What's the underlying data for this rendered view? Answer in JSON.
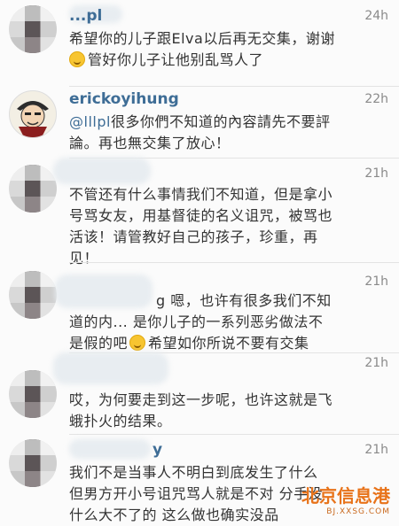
{
  "comments": [
    {
      "username": "...pl",
      "time": "24h",
      "text_1": "希望你的儿子跟Elva以后再无交集，谢谢",
      "text_2": "管好你儿子让他别乱骂人了"
    },
    {
      "username": "erickoyihung",
      "time": "22h",
      "mention": "@lllpl",
      "text_1": "很多你們不知道的內容請先不要評",
      "text_2": "論。再也無交集了放心！"
    },
    {
      "username": "",
      "time": "21h",
      "text_1": "不管还有什么事情我们不知道，但是拿小",
      "text_2": "号骂女友，用基督徒的名义诅咒，被骂也",
      "text_3": "活该！请管教好自己的孩子，珍重，再",
      "text_4": "见！"
    },
    {
      "username": "",
      "time": "21h",
      "text_1": "g 嗯，也许有很多我们不知",
      "text_2": "道的内... 是你儿子的一系列恶劣做法不",
      "text_3": "是假的吧",
      "text_4": "希望如你所说不要有交集"
    },
    {
      "username": "",
      "time": "21h",
      "text_1": "哎，为何要走到这一步呢，也许这就是飞",
      "text_2": "蛾扑火的结果。"
    },
    {
      "username": "y",
      "time": "21h",
      "text_1": "我们不是当事人不明白到底发生了什么",
      "text_2": "但男方开小号诅咒骂人就是不对 分手没",
      "text_3": "什么大不了的 这么做也确实没品"
    }
  ],
  "watermark": {
    "main": "北京信息港",
    "sub": "BJ.XXSG.COM"
  }
}
